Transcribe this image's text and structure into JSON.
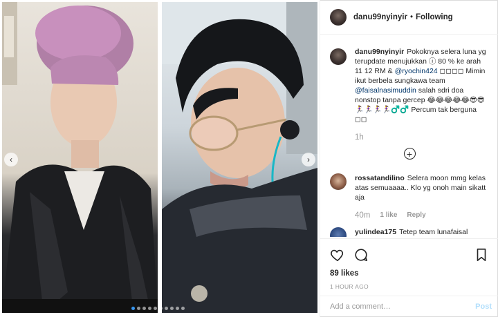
{
  "post": {
    "username": "danu99nyinyir",
    "separator": "•",
    "follow_status": "Following",
    "caption": {
      "text_1": "Pokoknya selera luna yg terupdate menujukkan ⓘ 80 % ke arah 11 12 RM & ",
      "mention_1": "@ryochin424",
      "text_2": " ◻◻◻◻ Mimin ikut berbela sungkawa team ",
      "mention_2": "@faisalnasimuddin",
      "text_3": " salah sdri doa nonstop tanpa gercep 😂😂😂😂😂😎😎 🏃‍♀️🏃‍♀️🏃‍♀️🏃‍♀️♂️♂️ Percum tak berguna ◻◻"
    },
    "caption_age": "1h"
  },
  "comments": [
    {
      "username": "rossatandilino",
      "text": "Selera moon mmg kelas atas semuaaaa.. Klo yg onoh main sikatt aja",
      "age": "40m",
      "likes": "1 like",
      "reply": "Reply"
    },
    {
      "username": "yulindea175",
      "text": "Tetep team lunafaisal"
    }
  ],
  "actions": {
    "likes": "89 likes",
    "timestamp": "1 HOUR AGO"
  },
  "composer": {
    "placeholder": "Add a comment…",
    "post_label": "Post"
  },
  "carousel": {
    "total_dots": 10,
    "active_index": 0,
    "prev_glyph": "‹",
    "next_glyph": "›"
  },
  "colors": {
    "link": "#003569",
    "accent": "#3897f0",
    "post_disabled": "#b2dffc"
  }
}
